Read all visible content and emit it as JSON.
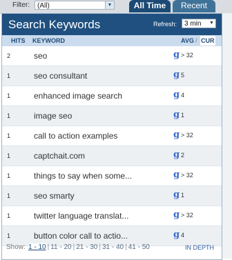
{
  "filter": {
    "label": "Filter:",
    "value": "(All)"
  },
  "tabs": [
    {
      "label": "All Time",
      "active": true
    },
    {
      "label": "Recent",
      "active": false
    }
  ],
  "panel": {
    "title": "Search Keywords",
    "refresh_label": "Refresh:",
    "refresh_value": "3 min"
  },
  "columns": {
    "hits": "HITS",
    "keyword": "KEYWORD",
    "avg": "AVG",
    "sep": "/",
    "cur": "CUR"
  },
  "rows": [
    {
      "hits": "2",
      "keyword": "seo",
      "rank": "> 32"
    },
    {
      "hits": "1",
      "keyword": "seo consultant",
      "rank": "5"
    },
    {
      "hits": "1",
      "keyword": "enhanced image search",
      "rank": "4"
    },
    {
      "hits": "1",
      "keyword": "image seo",
      "rank": "1"
    },
    {
      "hits": "1",
      "keyword": "call to action examples",
      "rank": "> 32"
    },
    {
      "hits": "1",
      "keyword": "captchait.com",
      "rank": "2"
    },
    {
      "hits": "1",
      "keyword": "things to say when some...",
      "rank": "> 32"
    },
    {
      "hits": "1",
      "keyword": "seo smarty",
      "rank": "1"
    },
    {
      "hits": "1",
      "keyword": "twitter language translat...",
      "rank": "> 32"
    },
    {
      "hits": "1",
      "keyword": "button color call to actio...",
      "rank": "4"
    }
  ],
  "google_icon_glyph": "g",
  "pager": {
    "show_label": "Show:",
    "pages": [
      "1 - 10",
      "11 - 20",
      "21 - 30",
      "31 - 40",
      "41 - 50"
    ],
    "current_index": 0,
    "separator": "|",
    "in_depth": "IN DEPTH"
  },
  "colors": {
    "header_bg": "#1f5080",
    "tab_active": "#1c4a74",
    "colhead_bg": "#cbdcee",
    "row_alt": "#edf0f3",
    "google_blue": "#3b68c9"
  }
}
